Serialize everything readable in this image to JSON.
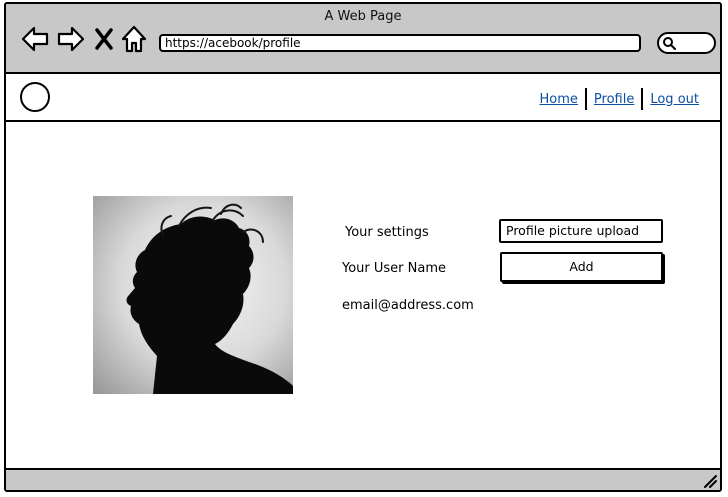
{
  "window": {
    "title": "A Web Page"
  },
  "browser": {
    "url": "https://acebook/profile",
    "icons": [
      "back-arrow-icon",
      "forward-arrow-icon",
      "close-x-icon",
      "home-icon",
      "search-icon"
    ]
  },
  "nav": {
    "home_label": "Home",
    "profile_label": "Profile",
    "logout_label": "Log out"
  },
  "profile": {
    "settings_label": "Your settings",
    "username_label": "Your User Name",
    "email": "email@address.com",
    "upload_label": "Profile picture upload",
    "add_button_label": "Add"
  },
  "colors": {
    "chrome": "#c8c8c8",
    "link": "#0b4fa5",
    "border": "#000000"
  }
}
